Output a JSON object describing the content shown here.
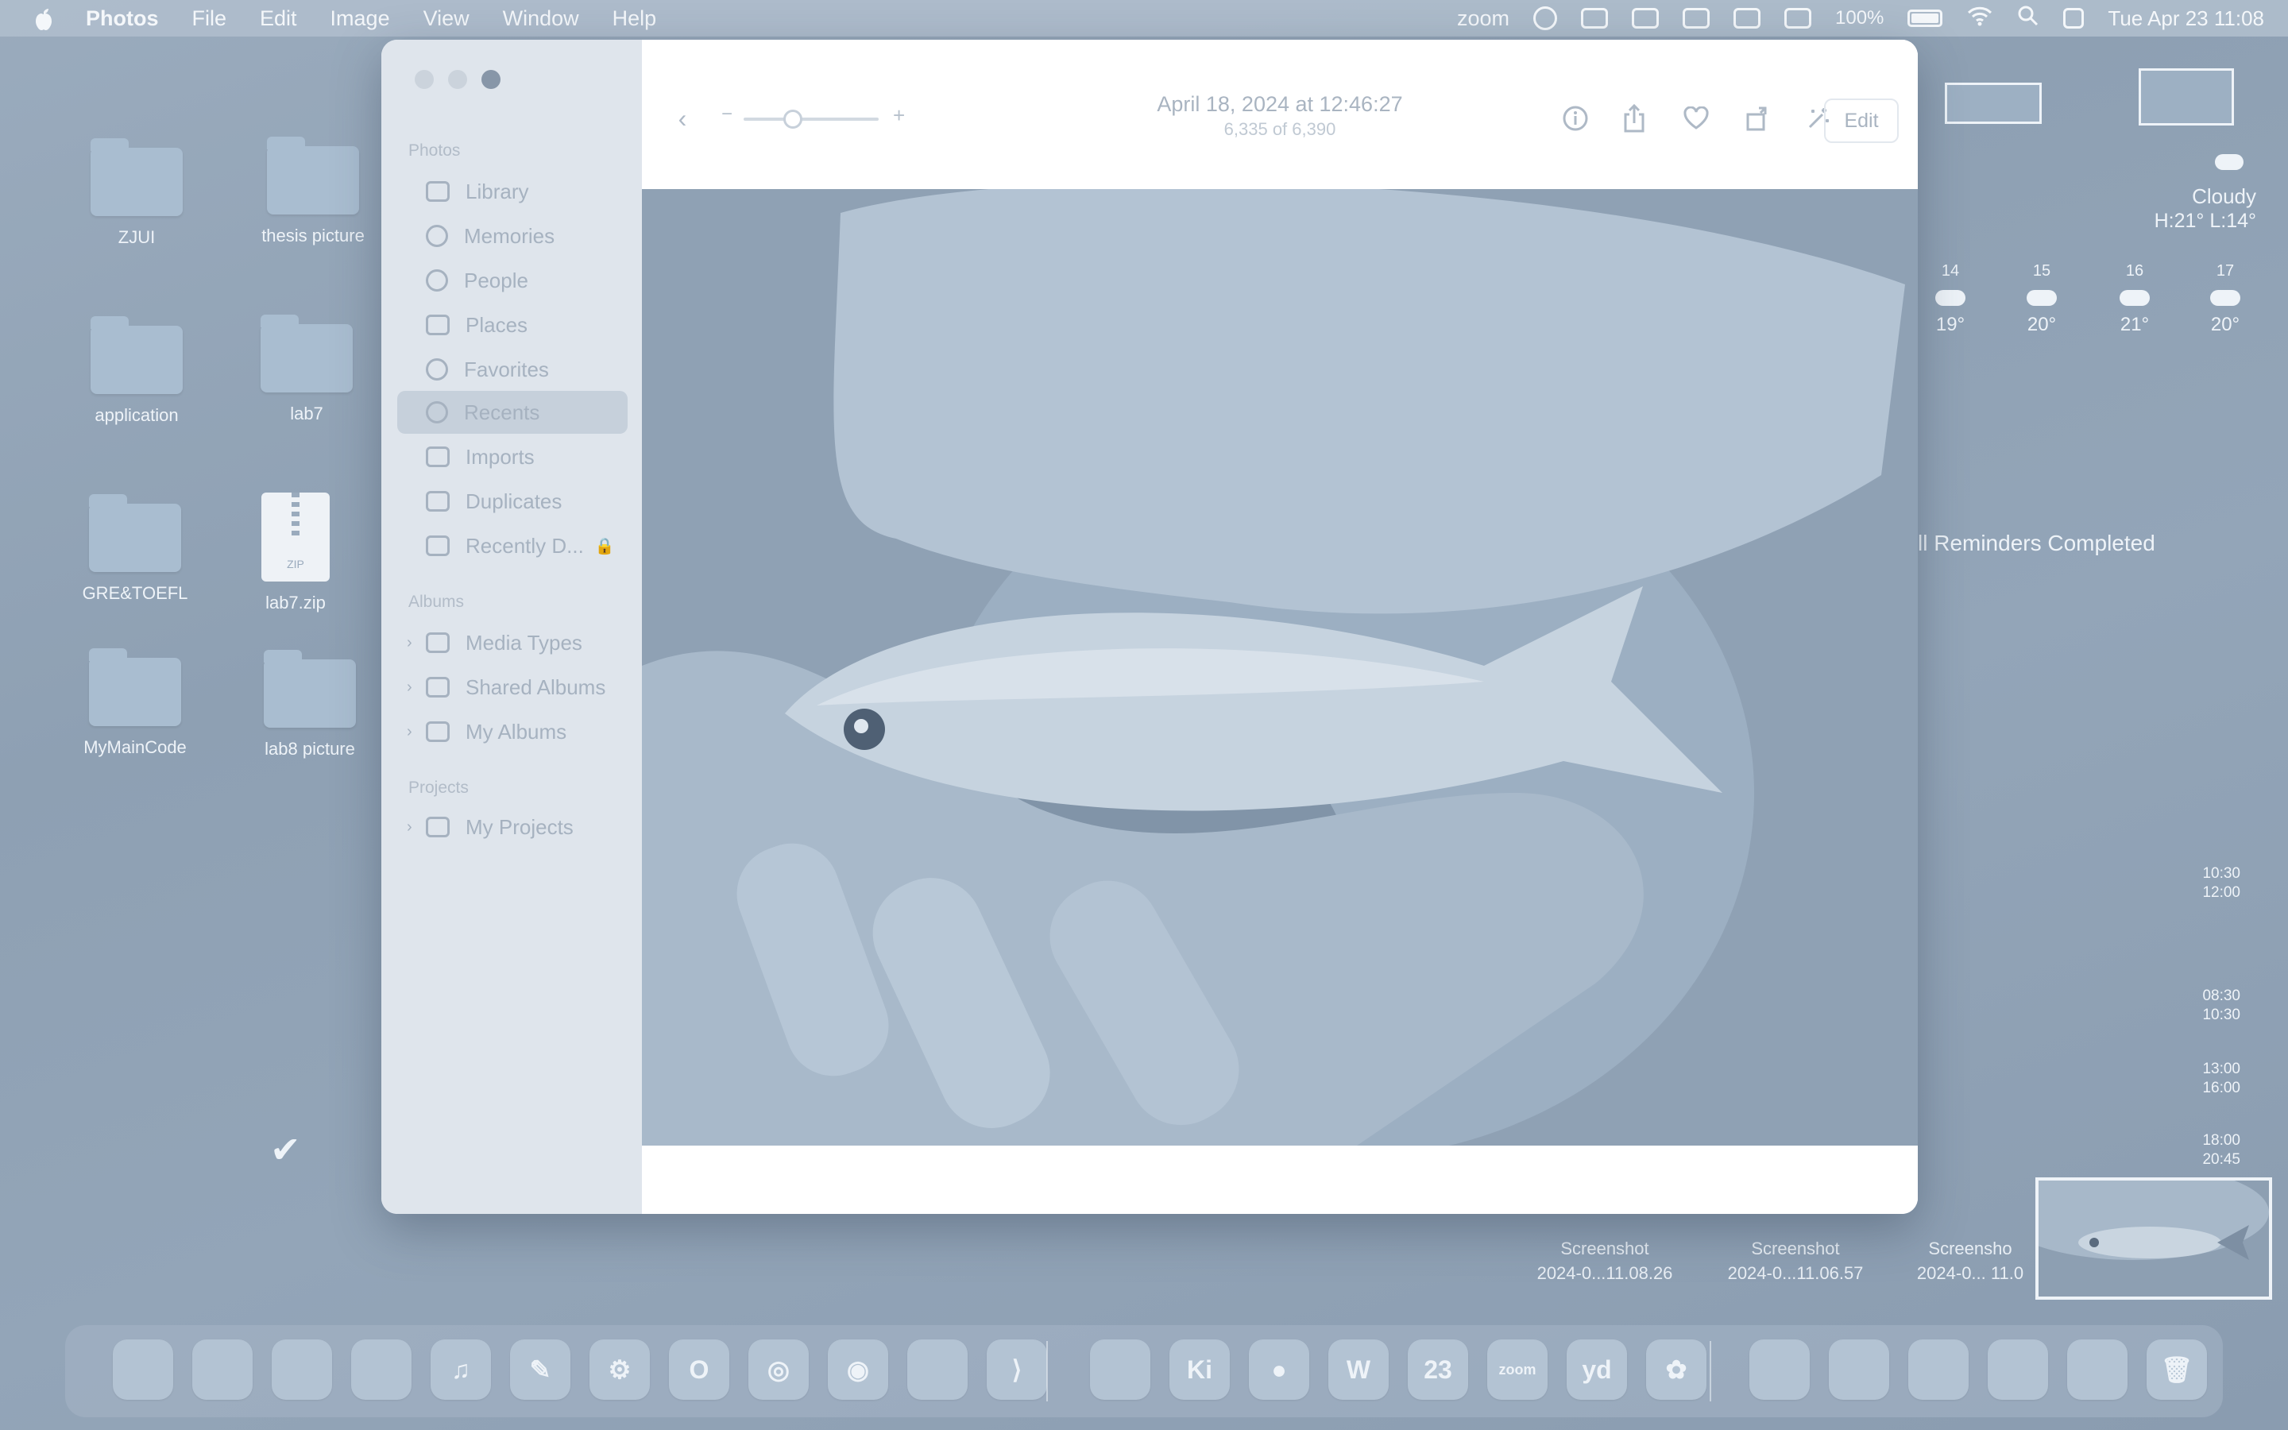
{
  "menubar": {
    "app_name": "Photos",
    "menus": [
      "File",
      "Edit",
      "Image",
      "View",
      "Window",
      "Help"
    ],
    "zoom_label": "zoom",
    "battery": "100%",
    "datetime": "Tue Apr 23  11:08"
  },
  "desktop": {
    "items": [
      {
        "label": "ZJUI",
        "kind": "folder"
      },
      {
        "label": "thesis picture",
        "kind": "folder"
      },
      {
        "label": "application",
        "kind": "folder"
      },
      {
        "label": "lab7",
        "kind": "folder"
      },
      {
        "label": "GRE&TOEFL",
        "kind": "folder"
      },
      {
        "label": "lab7.zip",
        "kind": "zip",
        "badge": "ZIP"
      },
      {
        "label": "MyMainCode",
        "kind": "folder"
      },
      {
        "label": "lab8 picture",
        "kind": "folder"
      }
    ]
  },
  "photos": {
    "sidebar": {
      "section_photos": "Photos",
      "items": [
        {
          "label": "Library",
          "icon": "library-icon"
        },
        {
          "label": "Memories",
          "icon": "memories-icon"
        },
        {
          "label": "People",
          "icon": "people-icon"
        },
        {
          "label": "Places",
          "icon": "places-icon"
        },
        {
          "label": "Favorites",
          "icon": "heart-icon"
        },
        {
          "label": "Recents",
          "icon": "clock-icon",
          "selected": true
        },
        {
          "label": "Imports",
          "icon": "import-icon"
        },
        {
          "label": "Duplicates",
          "icon": "duplicates-icon"
        },
        {
          "label": "Recently D...",
          "icon": "trash-icon"
        }
      ],
      "section_albums": "Albums",
      "albums": [
        "Media Types",
        "Shared Albums",
        "My Albums"
      ],
      "section_projects": "Projects",
      "projects": [
        "My Projects"
      ]
    },
    "toolbar": {
      "minus": "−",
      "plus": "+",
      "title": "April 18, 2024 at 12:46:27",
      "subtitle": "6,335 of 6,390",
      "edit_label": "Edit"
    }
  },
  "widgets": {
    "weather": {
      "condition": "Cloudy",
      "high_low": "H:21° L:14°",
      "forecast": [
        {
          "day": "14",
          "temp": "19°"
        },
        {
          "day": "15",
          "temp": "20°"
        },
        {
          "day": "16",
          "temp": "21°"
        },
        {
          "day": "17",
          "temp": "20°"
        }
      ]
    },
    "reminders": "ll Reminders Completed",
    "calendar_times": [
      "10:30\n12:00",
      "08:30\n10:30",
      "13:00\n16:00",
      "18:00\n20:45"
    ],
    "screenshots": [
      {
        "title": "Screenshot",
        "date": "2024-0...11.08.26"
      },
      {
        "title": "Screenshot",
        "date": "2024-0...11.06.57"
      },
      {
        "title": "Screensho",
        "date": "2024-0... 11.0"
      }
    ]
  },
  "dock": {
    "apps": [
      {
        "name": "finder-icon",
        "glyph": ""
      },
      {
        "name": "launchpad-icon",
        "glyph": ""
      },
      {
        "name": "safari-icon",
        "glyph": ""
      },
      {
        "name": "mail-icon",
        "glyph": ""
      },
      {
        "name": "music-icon",
        "glyph": "♫"
      },
      {
        "name": "pages-icon",
        "glyph": "✎"
      },
      {
        "name": "settings-icon",
        "glyph": "⚙"
      },
      {
        "name": "outlook-icon",
        "glyph": "O"
      },
      {
        "name": "chrome-icon",
        "glyph": "◎"
      },
      {
        "name": "camera-icon",
        "glyph": "◉"
      },
      {
        "name": "terminal-icon",
        "glyph": ""
      },
      {
        "name": "vscode-icon",
        "glyph": "⟩"
      },
      {
        "name": "preview-icon",
        "glyph": ""
      },
      {
        "name": "kimi-icon",
        "glyph": "Ki"
      },
      {
        "name": "wechat-icon",
        "glyph": "●"
      },
      {
        "name": "word-icon",
        "glyph": "W"
      },
      {
        "name": "calendar-icon",
        "glyph": "23"
      },
      {
        "name": "zoom-icon",
        "glyph": "zoom"
      },
      {
        "name": "youdao-icon",
        "glyph": "yd"
      },
      {
        "name": "photos-icon",
        "glyph": "✿"
      },
      {
        "name": "recent-file-1-icon",
        "glyph": ""
      },
      {
        "name": "recent-file-2-icon",
        "glyph": ""
      },
      {
        "name": "recent-file-3-icon",
        "glyph": ""
      },
      {
        "name": "recent-file-4-icon",
        "glyph": ""
      },
      {
        "name": "recent-file-5-icon",
        "glyph": ""
      },
      {
        "name": "trash-icon",
        "glyph": "🗑"
      }
    ]
  }
}
